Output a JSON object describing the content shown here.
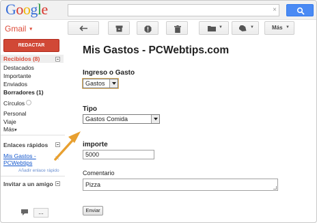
{
  "brand": {
    "logo_letters": [
      "G",
      "o",
      "o",
      "g",
      "l",
      "e"
    ],
    "logo_colors": [
      "#3a6fd8",
      "#d8342a",
      "#f0b400",
      "#3a6fd8",
      "#2e9d44",
      "#d8342a"
    ],
    "app_label": "Gmail"
  },
  "search": {
    "placeholder": "",
    "clear_glyph": "×"
  },
  "toolbar": {
    "more_label": "Más"
  },
  "sidebar": {
    "compose_label": "REDACTAR",
    "items": [
      {
        "label": "Recibidos (8)"
      },
      {
        "label": "Destacados"
      },
      {
        "label": "Importante"
      },
      {
        "label": "Enviados"
      },
      {
        "label": "Borradores (1)"
      },
      {
        "label": "Círculos"
      },
      {
        "label": "Personal"
      },
      {
        "label": "Viaje"
      },
      {
        "label": "Más"
      }
    ],
    "quick_links_title": "Enlaces rápidos",
    "quick_link_line1": "Mis Gastos -",
    "quick_link_line2": "PCWebtips",
    "add_quick_link": "Añadir enlace rápido",
    "invite_title": "Invitar a un amigo",
    "more_caret": "▾",
    "more_dots": "..."
  },
  "form": {
    "title": "Mis Gastos - PCWebtips.com",
    "type_label": "Ingreso o Gasto",
    "type_value": "Gastos",
    "category_label": "Tipo",
    "category_value": "Gastos Comida",
    "amount_label": "importe",
    "amount_value": "5000",
    "comment_label": "Comentario",
    "comment_value": "Pizza",
    "submit_label": "Enviar"
  },
  "colors": {
    "accent_red": "#d14836",
    "link_blue": "#1155cc",
    "search_blue": "#4a8af4",
    "annotation_arrow": "#e8a030"
  }
}
